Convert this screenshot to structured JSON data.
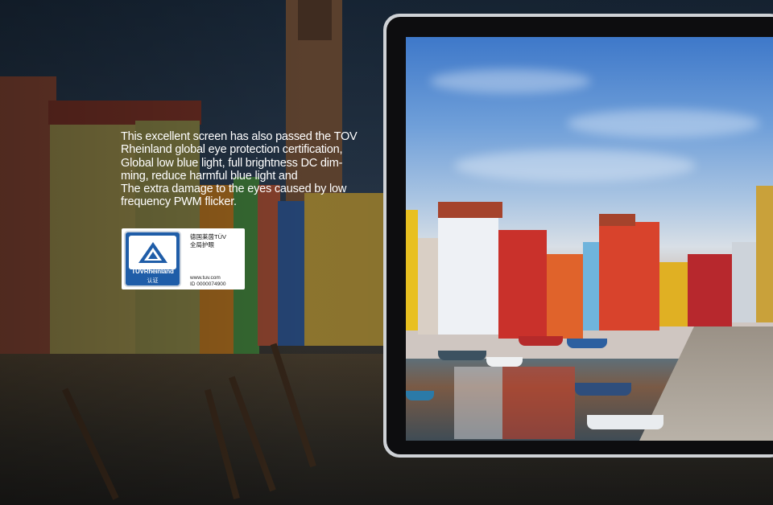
{
  "description": {
    "line1": "This excellent screen has also passed the TOV",
    "line2": "Rheinland global eye protection certification,",
    "line3": "Global low blue light, full brightness DC dim-",
    "line4": "ming, reduce harmful blue light and",
    "line5": "The extra damage to the eyes caused by low",
    "line6": "frequency PWM flicker."
  },
  "badge": {
    "brand": "TÜVRheinland",
    "cert": "认证",
    "cn_line1": "德国莱茵TÜV",
    "cn_line2": "全局护眼",
    "url": "www.tuv.com",
    "id": "ID  0000074900",
    "logo_color": "#1f5da8"
  },
  "tablet": {
    "frame_color": "#cfd2d6",
    "bezel_color": "#0d0d0f"
  }
}
